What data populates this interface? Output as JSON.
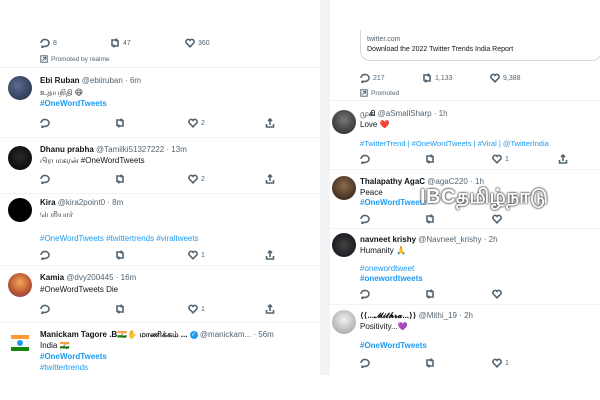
{
  "left": {
    "top_actions": {
      "reply": "8",
      "retweet": "47",
      "like": "360"
    },
    "promoted_by": "Promoted by realme",
    "tweets": [
      {
        "name": "Ebi Ruban",
        "handle": "@ebiiruban",
        "time": "· 6m",
        "lines": [
          "உதயநிதி 😄",
          "#OneWordTweets"
        ],
        "reply": "",
        "retweet": "",
        "like": "2",
        "share": ""
      },
      {
        "name": "Dhanu prabha",
        "handle": "@Tamilki51327222",
        "time": "· 13m",
        "lines": [
          "பிரபாகரன் #OneWordTweets"
        ],
        "reply": "",
        "retweet": "",
        "like": "2",
        "share": ""
      },
      {
        "name": "Kira",
        "handle": "@kira2point0",
        "time": "· 8m",
        "lines": [
          "பெரியார்",
          "#OneWordTweets #twittertrends #viraltweets"
        ],
        "reply": "",
        "retweet": "",
        "like": "1",
        "share": ""
      },
      {
        "name": "Kamia",
        "handle": "@dvy200445",
        "time": "· 16m",
        "lines": [
          "#OneWordTweets Die"
        ],
        "reply": "",
        "retweet": "",
        "like": "1",
        "share": ""
      },
      {
        "name": "Manickam Tagore .B🇮🇳✋ மாணிக்கம் ...",
        "handle": "@manickam...",
        "time": "· 56m",
        "lines": [
          "India 🇮🇳",
          "#OneWordTweets",
          "#twittertrends"
        ]
      }
    ]
  },
  "right": {
    "card": {
      "domain": "twitter.com",
      "title": "Download the 2022 Twitter Trends India Report"
    },
    "top_actions": {
      "reply": "217",
      "retweet": "1,133",
      "like": "9,388"
    },
    "promoted": "Promoted",
    "tweets": [
      {
        "name": "முகி",
        "handle": "@aSmallSharp",
        "time": "· 1h",
        "lines": [
          "Love ❤️",
          "#TwitterTrend | #OneWordTweets | #Viral | @TwitterIndia"
        ],
        "reply": "",
        "retweet": "",
        "like": "1",
        "share": ""
      },
      {
        "name": "Thalapathy AgaC",
        "handle": "@agaC220",
        "time": "· 1h",
        "lines": [
          "Peace",
          "#OneWordTweets"
        ],
        "reply": "",
        "retweet": "",
        "like": "",
        "share": ""
      },
      {
        "name": "navneet krishy",
        "handle": "@Navneet_krishy",
        "time": "· 2h",
        "lines": [
          "Humanity 🙏",
          "#onewordtweet",
          "#onewordtweets"
        ],
        "reply": "",
        "retweet": "",
        "like": "",
        "share": ""
      },
      {
        "name": "⟨⟨...𝓜𝓲𝓽𝓱𝓻𝓪...⟩⟩",
        "handle": "@Mithi_19",
        "time": "· 2h",
        "lines": [
          "Positivity...💜",
          "#OneWordTweets"
        ],
        "reply": "",
        "retweet": "",
        "like": "1",
        "share": ""
      }
    ]
  },
  "watermark": "IBCதமிழ்நாடு",
  "colors": {
    "accent": "#1d9bf0",
    "text": "#0f1419",
    "muted": "#536471",
    "like": "#e0245e"
  }
}
